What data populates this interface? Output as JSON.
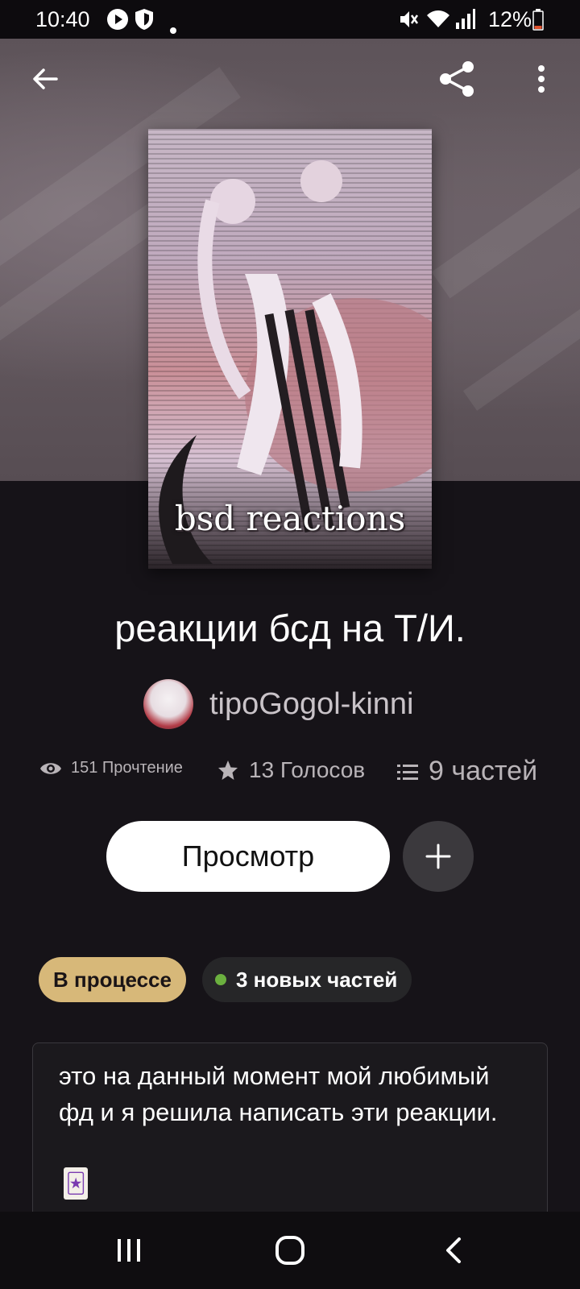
{
  "status_bar": {
    "time": "10:40",
    "battery": "12%",
    "icons": [
      "play-icon",
      "shield-icon",
      "dot-icon",
      "mute-icon",
      "wifi-icon",
      "signal-icon",
      "battery-icon"
    ]
  },
  "top_bar": {
    "icons": [
      "back-arrow-icon",
      "share-icon",
      "more-vert-icon"
    ]
  },
  "cover": {
    "text": "bsd reactions"
  },
  "story": {
    "title": "реакции бсд на Т/И.",
    "author": "tipoGogol-kinni",
    "stats": {
      "reads": "151 Прочтение",
      "votes": "13 Голосов",
      "parts": "9 частей"
    },
    "view_button": "Просмотр",
    "status_label": "В процессе",
    "new_parts_label": "3 новых частей",
    "description": "это на данный момент мой любимый фд и я решила написать эти реакции."
  },
  "colors": {
    "background": "#161318",
    "status_pill": "#d7b879",
    "new_dot": "#6bb03f"
  }
}
